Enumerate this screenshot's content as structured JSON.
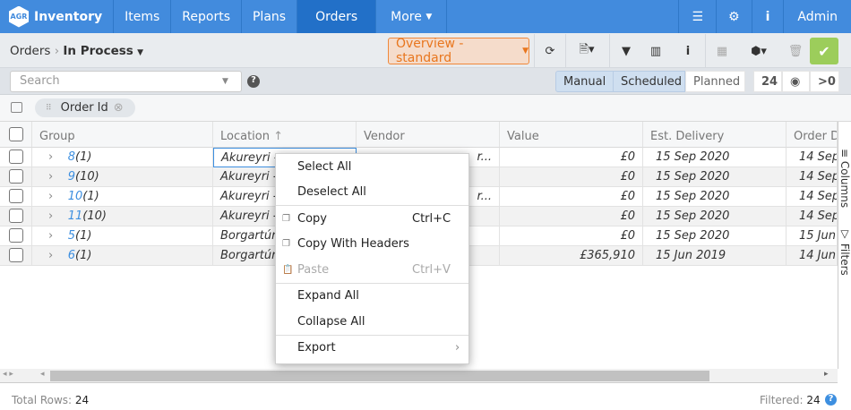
{
  "nav": {
    "logo": "AGR",
    "app": "Inventory",
    "items": [
      "Items",
      "Reports",
      "Plans",
      "Orders",
      "More"
    ],
    "active": "Orders",
    "admin": "Admin"
  },
  "toolbar": {
    "crumb_root": "Orders",
    "crumb_current": "In Process",
    "view": "Overview - standard"
  },
  "search": {
    "placeholder": "Search"
  },
  "modes": [
    "Manual",
    "Scheduled",
    "Planned"
  ],
  "counters": {
    "count": "24",
    "zero": ">0"
  },
  "grouping": {
    "chip": "Order Id"
  },
  "table": {
    "headers": [
      "Group",
      "Location",
      "Vendor",
      "Value",
      "Est. Delivery",
      "Order D"
    ],
    "rows": [
      {
        "id": "8",
        "count": "(1)",
        "location": "Akureyri -",
        "vendor": "r...",
        "value": "£0",
        "delivery": "15 Sep 2020",
        "order": "14 Sep"
      },
      {
        "id": "9",
        "count": "(10)",
        "location": "Akureyri -",
        "vendor": "",
        "value": "£0",
        "delivery": "15 Sep 2020",
        "order": "14 Sep"
      },
      {
        "id": "10",
        "count": "(1)",
        "location": "Akureyri -",
        "vendor": "r...",
        "value": "£0",
        "delivery": "15 Sep 2020",
        "order": "14 Sep"
      },
      {
        "id": "11",
        "count": "(10)",
        "location": "Akureyri -",
        "vendor": "",
        "value": "£0",
        "delivery": "15 Sep 2020",
        "order": "14 Sep"
      },
      {
        "id": "5",
        "count": "(1)",
        "location": "Borgartún",
        "vendor": "",
        "value": "£0",
        "delivery": "15 Sep 2020",
        "order": "15 Jun"
      },
      {
        "id": "6",
        "count": "(1)",
        "location": "Borgartún",
        "vendor": "",
        "value": "£365,910",
        "delivery": "15 Jun 2019",
        "order": "14 Jun"
      }
    ]
  },
  "menu": {
    "select_all": "Select All",
    "deselect_all": "Deselect All",
    "copy": "Copy",
    "copy_sc": "Ctrl+C",
    "copy_headers": "Copy With Headers",
    "paste": "Paste",
    "paste_sc": "Ctrl+V",
    "expand": "Expand All",
    "collapse": "Collapse All",
    "export": "Export"
  },
  "side": {
    "columns": "Columns",
    "filters": "Filters"
  },
  "footer": {
    "total_label": "Total Rows:",
    "total": "24",
    "filtered_label": "Filtered:",
    "filtered": "24"
  },
  "colors": {
    "nav": "#428bdd",
    "active": "#2270c8",
    "accent_orange": "#e8761e",
    "ok": "#9ccd5b",
    "link": "#3d8fe0"
  }
}
